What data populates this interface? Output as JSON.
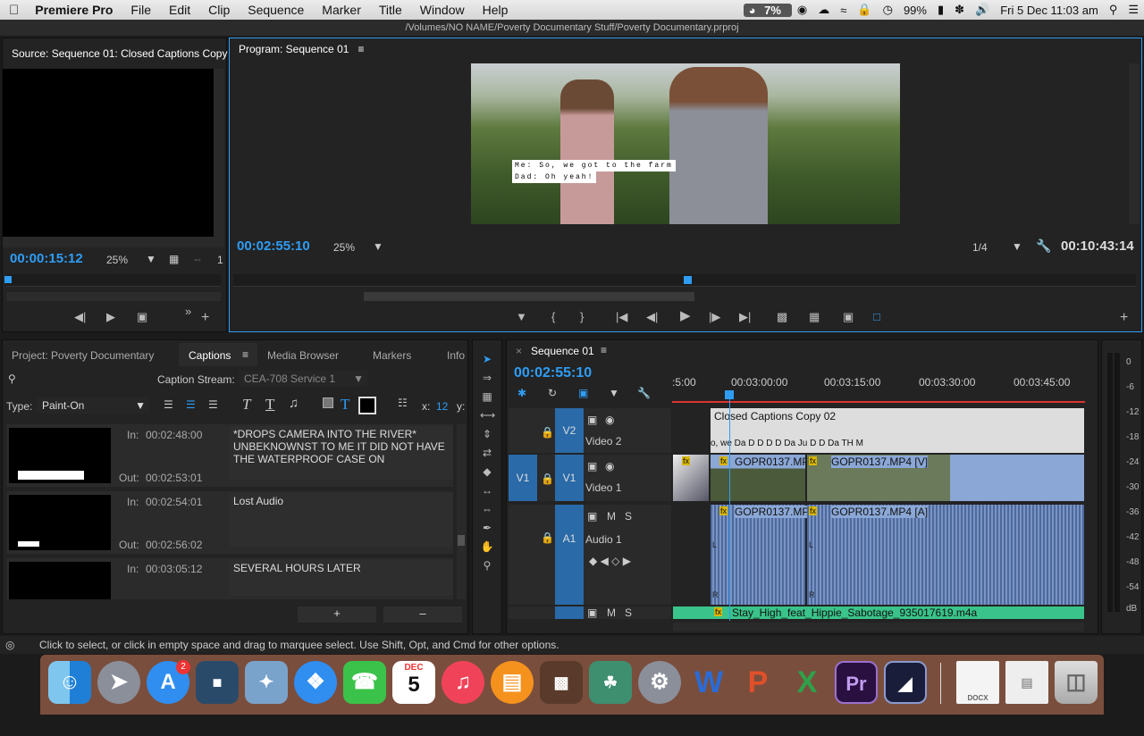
{
  "menubar": {
    "apple": "",
    "app": "Premiere Pro",
    "items": [
      "File",
      "Edit",
      "Clip",
      "Sequence",
      "Marker",
      "Title",
      "Window",
      "Help"
    ],
    "status_cpu": "7%",
    "battery": "99%",
    "datetime": "Fri 5 Dec  11:03 am"
  },
  "window_title": "/Volumes/NO NAME/Poverty Documentary Stuff/Poverty Documentary.prproj",
  "source": {
    "tab": "Source: Sequence 01: Closed Captions Copy",
    "timecode": "00:00:15:12",
    "zoom": "25%",
    "page": "1"
  },
  "program": {
    "tab": "Program: Sequence 01",
    "timecode": "00:02:55:10",
    "zoom": "25%",
    "resolution": "1/4",
    "duration": "00:10:43:14",
    "caption_line1": "Me: So, we got to the farm",
    "caption_line2": "Dad: Oh yeah!"
  },
  "project_tabs": [
    "Project: Poverty Documentary",
    "Captions",
    "Media Browser",
    "Markers",
    "Info"
  ],
  "captions": {
    "stream_label": "Caption Stream:",
    "stream_value": "CEA-708 Service 1",
    "type_label": "Type:",
    "type_value": "Paint-On",
    "x_label": "x:",
    "x_value": "12",
    "y_label": "y:",
    "in_label": "In:",
    "out_label": "Out:",
    "items": [
      {
        "in": "00:02:48:00",
        "out": "00:02:53:01",
        "text": "*DROPS CAMERA INTO THE RIVER* UNBEKNOWNST TO ME IT DID NOT HAVE THE WATERPROOF CASE ON"
      },
      {
        "in": "00:02:54:01",
        "out": "00:02:56:02",
        "text": "Lost Audio"
      },
      {
        "in": "00:03:05:12",
        "out": "",
        "text": "SEVERAL HOURS LATER"
      }
    ],
    "add": "+",
    "remove": "–"
  },
  "timeline": {
    "tab": "Sequence 01",
    "timecode": "00:02:55:10",
    "ruler": [
      ":5:00",
      "00:03:00:00",
      "00:03:15:00",
      "00:03:30:00",
      "00:03:45:00"
    ],
    "tracks": {
      "v2": {
        "id": "V2",
        "name": "Video 2",
        "clip": "Closed Captions Copy 02",
        "markers": "o, we  Da  D  D  D  D  Da  Ju  D  D  Da  TH  M"
      },
      "v1": {
        "src": "V1",
        "id": "V1",
        "name": "Video 1",
        "clip1": "GOPR0137.MP4",
        "clip2": "GOPR0137.MP4 [V]"
      },
      "a1": {
        "id": "A1",
        "name": "Audio 1",
        "clip1": "GOPR0137.MP4",
        "clip2": "GOPR0137.MP4 [A]",
        "l": "L",
        "r": "R"
      },
      "a2": {
        "clip": "Stay_High_feat_Hippie_Sabotage_935017619.m4a"
      }
    },
    "m": "M",
    "s": "S",
    "fx": "fx"
  },
  "meter": [
    "0",
    "-6",
    "-12",
    "-18",
    "-24",
    "-30",
    "-36",
    "-42",
    "-48",
    "-54",
    "dB"
  ],
  "status": "Click to select, or click in empty space and drag to marquee select. Use Shift, Opt, and Cmd for other options.",
  "dock": {
    "badge": "2",
    "calendar_month": "DEC",
    "calendar_day": "5",
    "docx": "DOCX"
  },
  "colors": {
    "accent": "#2e9df5",
    "track": "#2a6aa8"
  }
}
